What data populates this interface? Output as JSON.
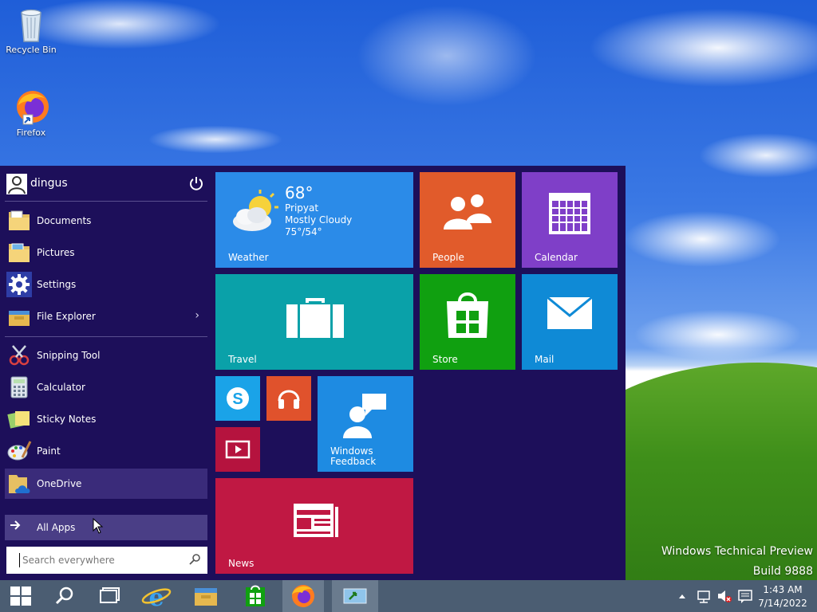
{
  "desktop": {
    "icons": [
      {
        "label": "Recycle Bin",
        "icon": "recycle-bin-icon"
      },
      {
        "label": "Firefox",
        "icon": "firefox-icon"
      }
    ],
    "watermark": {
      "line1": "Windows Technical Preview",
      "line2": "Build 9888"
    }
  },
  "start_menu": {
    "user": {
      "name": "dingus"
    },
    "places": [
      {
        "label": "Documents",
        "icon": "documents-folder-icon"
      },
      {
        "label": "Pictures",
        "icon": "pictures-folder-icon"
      },
      {
        "label": "Settings",
        "icon": "gear-icon"
      },
      {
        "label": "File Explorer",
        "icon": "file-explorer-icon",
        "arrow": "›"
      }
    ],
    "apps": [
      {
        "label": "Snipping Tool",
        "icon": "snipping-tool-icon"
      },
      {
        "label": "Calculator",
        "icon": "calculator-icon"
      },
      {
        "label": "Sticky Notes",
        "icon": "sticky-notes-icon"
      },
      {
        "label": "Paint",
        "icon": "paint-icon"
      },
      {
        "label": "OneDrive",
        "icon": "onedrive-icon"
      }
    ],
    "all_apps": {
      "label": "All Apps"
    },
    "search": {
      "placeholder": "Search everywhere"
    },
    "tiles": {
      "weather": {
        "label": "Weather",
        "temp": "68°",
        "city": "Pripyat",
        "condition": "Mostly Cloudy",
        "range": "75°/54°",
        "color": "#2b8be8"
      },
      "people": {
        "label": "People",
        "color": "#e15b2b"
      },
      "calendar": {
        "label": "Calendar",
        "color": "#7f3fc8"
      },
      "travel": {
        "label": "Travel",
        "color": "#0aa1a9"
      },
      "store": {
        "label": "Store",
        "color": "#10a010"
      },
      "mail": {
        "label": "Mail",
        "color": "#0f8ad6"
      },
      "skype": {
        "color": "#1aa3e8"
      },
      "music": {
        "color": "#e0522c"
      },
      "video": {
        "color": "#b5133e"
      },
      "feedback": {
        "label_line1": "Windows",
        "label_line2": "Feedback",
        "color": "#1e8be2"
      },
      "news": {
        "label": "News",
        "color": "#c01843"
      }
    }
  },
  "taskbar": {
    "buttons": [
      "start-button",
      "search-button",
      "task-view-button",
      "internet-explorer-button",
      "file-explorer-button",
      "store-button",
      "firefox-button",
      "app-button"
    ],
    "tray": {
      "time": "1:43 AM",
      "date": "7/14/2022"
    }
  }
}
